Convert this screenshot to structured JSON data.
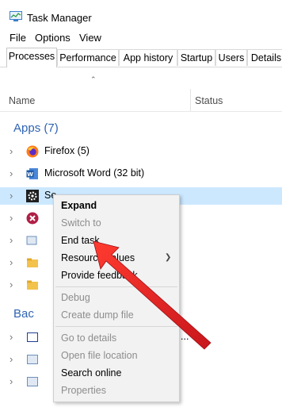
{
  "window": {
    "title": "Task Manager"
  },
  "menu": [
    "File",
    "Options",
    "View"
  ],
  "tabs": [
    "Processes",
    "Performance",
    "App history",
    "Startup",
    "Users",
    "Details"
  ],
  "active_tab": "Processes",
  "columns": {
    "name": "Name",
    "status": "Status"
  },
  "groups": {
    "apps": "Apps (7)",
    "background": "Bac"
  },
  "rows": [
    {
      "label": "Firefox (5)",
      "icon": "firefox-icon"
    },
    {
      "label": "Microsoft Word (32 bit)",
      "icon": "word-icon"
    },
    {
      "label": "Se",
      "icon": "settings-icon"
    }
  ],
  "context_menu": {
    "items": [
      {
        "label": "Expand",
        "state": "bold"
      },
      {
        "label": "Switch to",
        "state": "disabled"
      },
      {
        "label": "End task",
        "state": "enabled"
      },
      {
        "label": "Resource values",
        "state": "enabled"
      },
      {
        "label": "Provide feedback",
        "state": "enabled"
      },
      {
        "label": "Debug",
        "state": "disabled"
      },
      {
        "label": "Create dump file",
        "state": "disabled"
      },
      {
        "label": "Go to details",
        "state": "disabled"
      },
      {
        "label": "Open file location",
        "state": "disabled"
      },
      {
        "label": "Search online",
        "state": "enabled"
      },
      {
        "label": "Properties",
        "state": "disabled"
      }
    ]
  },
  "colors": {
    "selection": "#cce8ff",
    "group_label": "#2f63b3",
    "annotation_arrow": "#e3262b"
  }
}
